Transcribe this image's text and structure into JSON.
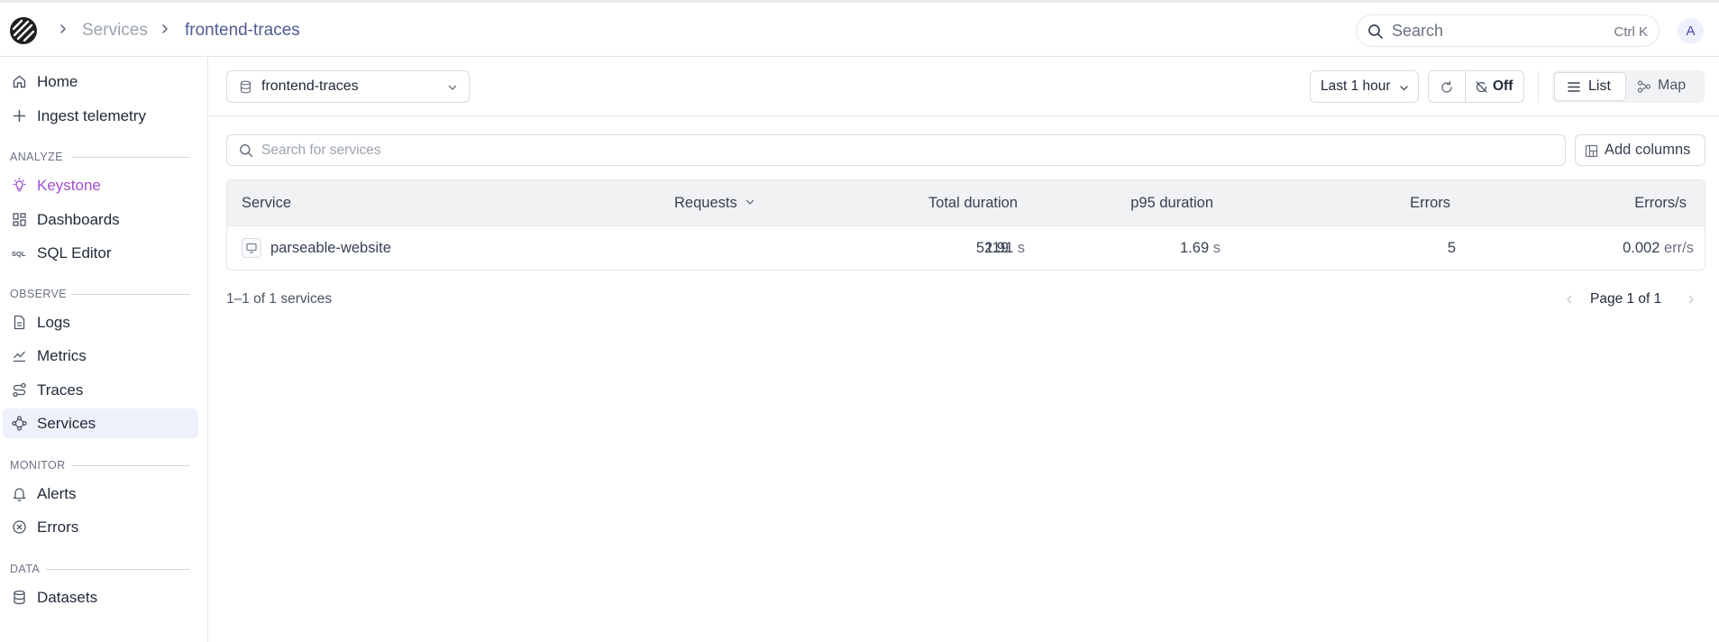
{
  "breadcrumb": {
    "services": "Services",
    "current": "frontend-traces"
  },
  "global_search": {
    "label": "Search",
    "shortcut": "Ctrl K"
  },
  "user": {
    "avatar_initial": "A"
  },
  "sidebar": {
    "top_items": [
      {
        "label": "Home",
        "icon": "home-icon"
      },
      {
        "label": "Ingest telemetry",
        "icon": "plus-icon"
      }
    ],
    "sections": {
      "analyze": "ANALYZE",
      "observe": "OBSERVE",
      "monitor": "MONITOR",
      "data": "DATA"
    },
    "analyze_items": [
      {
        "label": "Keystone",
        "icon": "lightbulb-icon"
      },
      {
        "label": "Dashboards",
        "icon": "dashboard-icon"
      },
      {
        "label": "SQL Editor",
        "icon": "sql-icon"
      }
    ],
    "observe_items": [
      {
        "label": "Logs",
        "icon": "document-icon"
      },
      {
        "label": "Metrics",
        "icon": "chart-line-icon"
      },
      {
        "label": "Traces",
        "icon": "traces-icon"
      },
      {
        "label": "Services",
        "icon": "services-icon"
      }
    ],
    "monitor_items": [
      {
        "label": "Alerts",
        "icon": "bell-icon"
      },
      {
        "label": "Errors",
        "icon": "error-circle-icon"
      }
    ],
    "data_items": [
      {
        "label": "Datasets",
        "icon": "database-icon"
      }
    ],
    "active_item": "Services",
    "highlight_color": "#a24fcf"
  },
  "toolbar": {
    "dataset": "frontend-traces",
    "time_range": "Last 1 hour",
    "auto_refresh": "Off",
    "view_list": "List",
    "view_map": "Map"
  },
  "services_search": {
    "placeholder": "Search for services"
  },
  "add_columns_label": "Add columns",
  "table": {
    "headers": [
      "Service",
      "Requests",
      "Total duration",
      "p95 duration",
      "Errors",
      "Errors/s"
    ],
    "rows": [
      {
        "service": "parseable-website",
        "requests": "119",
        "total_duration": "52.91",
        "total_duration_unit": "s",
        "p95_duration": "1.69",
        "p95_duration_unit": "s",
        "errors": "5",
        "errors_per_sec": "0.002",
        "errors_per_sec_unit": "err/s"
      }
    ]
  },
  "footer": {
    "count": "1–1 of 1 services",
    "page": "Page 1 of 1"
  },
  "colors": {
    "accent": "#4f5b93",
    "active_bg": "#eef0fb"
  }
}
